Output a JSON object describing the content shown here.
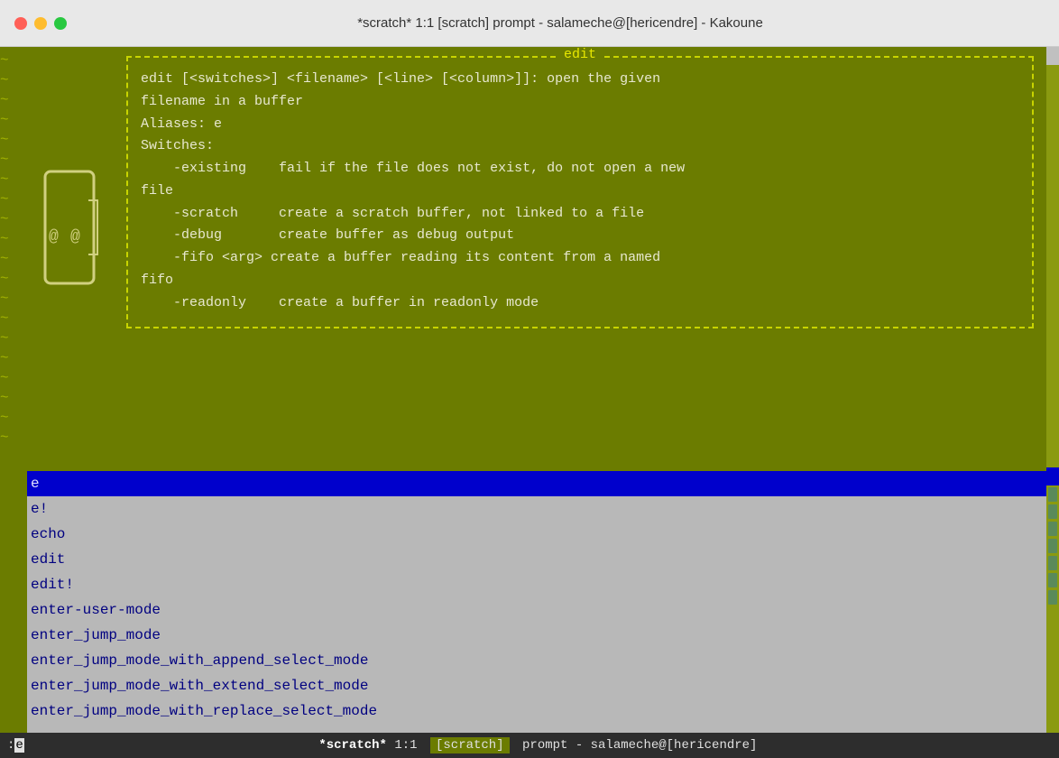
{
  "titlebar": {
    "title": "*scratch* 1:1 [scratch] prompt - salameche@[hericendre] - Kakoune"
  },
  "popup": {
    "header": "edit",
    "lines": [
      "edit [<switches>] <filename> [<line> [<column>]]: open the given",
      "filename in a buffer",
      "Aliases: e",
      "Switches:",
      "    -existing    fail if the file does not exist, do not open a new",
      "file",
      "    -scratch     create a scratch buffer, not linked to a file",
      "    -debug       create buffer as debug output",
      "    -fifo <arg>  create a buffer reading its content from a named",
      "fifo",
      "    -readonly    create a buffer in readonly mode"
    ]
  },
  "completions": {
    "input": "e",
    "items": [
      "e!",
      "echo",
      "edit",
      "edit!",
      "enter-user-mode",
      "enter_jump_mode",
      "enter_jump_mode_with_append_select_mode",
      "enter_jump_mode_with_extend_select_mode",
      "enter_jump_mode_with_replace_select_mode"
    ]
  },
  "statusbar": {
    "prompt_prefix": ": e",
    "buffer": "*scratch*",
    "position": "1:1",
    "tag": "[scratch]",
    "right": "prompt - salameche@[hericendre]"
  },
  "tildes": [
    "~",
    "~",
    "~",
    "~",
    "~",
    "~",
    "~",
    "~",
    "~",
    "~",
    "~",
    "~",
    "~",
    "~",
    "~",
    "~",
    "~",
    "~",
    "~"
  ]
}
